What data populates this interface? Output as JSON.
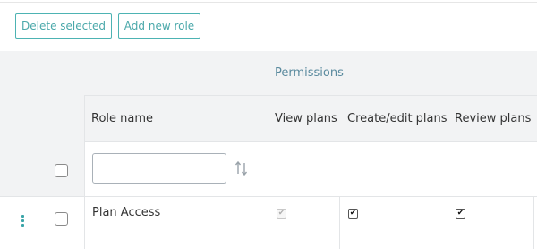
{
  "toolbar": {
    "delete_label": "Delete selected",
    "add_label": "Add new role"
  },
  "table": {
    "group_header": "Permissions",
    "columns": {
      "role_name": "Role name",
      "view_plans": "View plans",
      "create_edit_plans": "Create/edit plans",
      "review_plans": "Review plans"
    },
    "filter": {
      "value": "",
      "placeholder": ""
    },
    "rows": [
      {
        "role_name": "Plan Access",
        "selected": false,
        "view_plans": {
          "checked": true,
          "disabled": true
        },
        "create_edit_plans": {
          "checked": true,
          "disabled": false
        },
        "review_plans": {
          "checked": true,
          "disabled": false
        }
      }
    ]
  },
  "colors": {
    "accent": "#4aa8aa",
    "header_bg": "#f2f3f4",
    "group_title": "#5a8a9e",
    "grid_line": "#e3e5e7"
  },
  "icons": {
    "sort": "sort-icon",
    "drag": "drag-handle-icon",
    "check": "✔"
  }
}
